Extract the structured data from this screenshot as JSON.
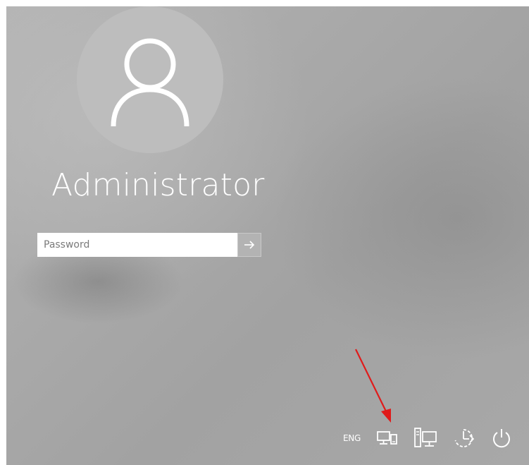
{
  "user": {
    "name": "Administrator",
    "avatar_icon": "user-silhouette-icon"
  },
  "password": {
    "placeholder": "Password",
    "value": "",
    "submit_icon": "arrow-right-icon"
  },
  "tray": {
    "language": "ENG",
    "icons": [
      "network-icon",
      "remote-desktop-icon",
      "accessibility-icon",
      "power-icon"
    ]
  },
  "annotation": {
    "arrow_color": "#e01b1b",
    "points_to": "network-icon"
  },
  "colors": {
    "background": "#a9a9a9",
    "avatar_bg": "#bdbdbd",
    "text": "#ffffff"
  }
}
